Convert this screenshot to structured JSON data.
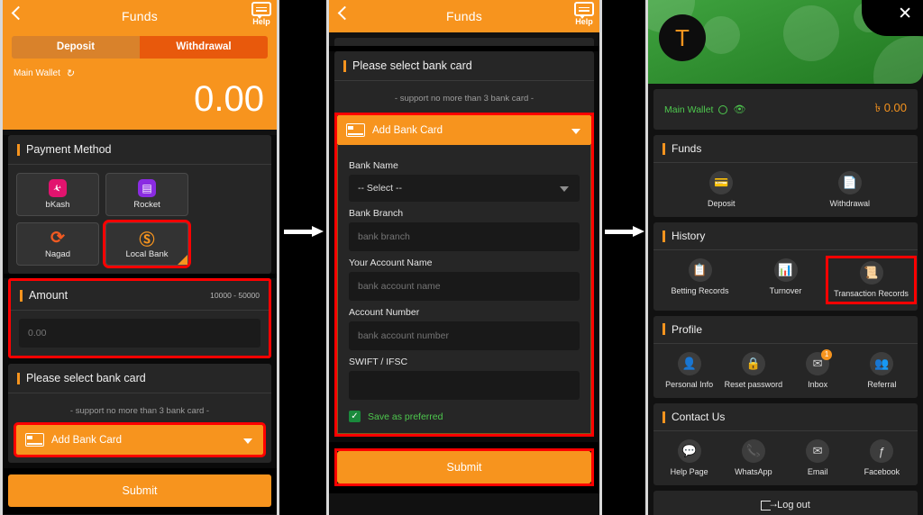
{
  "panels": {
    "left": {
      "header": {
        "title": "Funds",
        "help_label": "Help",
        "back_icon": "back-chevron-icon",
        "help_icon": "help-chat-icon"
      },
      "tabs": [
        {
          "label": "Deposit",
          "active": false
        },
        {
          "label": "Withdrawal",
          "active": true
        }
      ],
      "wallet": {
        "label": "Main Wallet",
        "refresh_icon": "refresh-icon",
        "balance": "0.00"
      },
      "payment_method": {
        "title": "Payment Method",
        "methods": [
          {
            "label": "bKash",
            "icon": "bkash-icon",
            "selected": false
          },
          {
            "label": "Rocket",
            "icon": "rocket-icon",
            "selected": false
          },
          {
            "label": "Nagad",
            "icon": "nagad-icon",
            "selected": false
          },
          {
            "label": "Local Bank",
            "icon": "local-bank-icon",
            "selected": true
          }
        ]
      },
      "amount": {
        "title": "Amount",
        "range": "10000 - 50000",
        "placeholder": "0.00",
        "value": ""
      },
      "bank_card": {
        "title": "Please select bank card",
        "note": "- support no more than 3 bank card -",
        "add_label": "Add Bank Card",
        "card_icon": "bank-card-icon",
        "caret_icon": "chevron-down-icon"
      },
      "submit_label": "Submit"
    },
    "mid": {
      "header": {
        "title": "Funds",
        "help_label": "Help",
        "back_icon": "back-chevron-icon",
        "help_icon": "help-chat-icon"
      },
      "bank_card": {
        "title": "Please select bank card",
        "note": "- support no more than 3 bank card -",
        "add_label": "Add Bank Card",
        "card_icon": "bank-card-icon",
        "caret_icon": "chevron-down-icon"
      },
      "form": {
        "fields": [
          {
            "label": "Bank Name",
            "type": "select",
            "value": "-- Select --",
            "placeholder": ""
          },
          {
            "label": "Bank Branch",
            "type": "text",
            "value": "",
            "placeholder": "bank branch"
          },
          {
            "label": "Your Account Name",
            "type": "text",
            "value": "",
            "placeholder": "bank account name"
          },
          {
            "label": "Account Number",
            "type": "text",
            "value": "",
            "placeholder": "bank account number"
          },
          {
            "label": "SWIFT / IFSC",
            "type": "text",
            "value": "",
            "placeholder": ""
          }
        ],
        "checkbox": {
          "label": "Save as preferred",
          "checked": true
        }
      },
      "submit_label": "Submit"
    },
    "right": {
      "avatar_initial": "T",
      "close_icon": "close-icon",
      "wallet": {
        "label": "Main Wallet",
        "refresh_icon": "refresh-icon",
        "eye_icon": "eye-icon",
        "balance": "৳ 0.00"
      },
      "sections": [
        {
          "title": "Funds",
          "items": [
            {
              "label": "Deposit",
              "icon": "deposit-card-icon",
              "highlighted": false,
              "badge": ""
            },
            {
              "label": "Withdrawal",
              "icon": "withdrawal-card-icon",
              "highlighted": false,
              "badge": ""
            }
          ]
        },
        {
          "title": "History",
          "items": [
            {
              "label": "Betting Records",
              "icon": "betting-records-icon",
              "highlighted": false,
              "badge": ""
            },
            {
              "label": "Turnover",
              "icon": "turnover-icon",
              "highlighted": false,
              "badge": ""
            },
            {
              "label": "Transaction Records",
              "icon": "transaction-records-icon",
              "highlighted": true,
              "badge": ""
            }
          ]
        },
        {
          "title": "Profile",
          "items": [
            {
              "label": "Personal Info",
              "icon": "person-icon",
              "highlighted": false,
              "badge": ""
            },
            {
              "label": "Reset password",
              "icon": "lock-icon",
              "highlighted": false,
              "badge": ""
            },
            {
              "label": "Inbox",
              "icon": "envelope-icon",
              "highlighted": false,
              "badge": "1"
            },
            {
              "label": "Referral",
              "icon": "referral-icon",
              "highlighted": false,
              "badge": ""
            }
          ]
        },
        {
          "title": "Contact Us",
          "items": [
            {
              "label": "Help Page",
              "icon": "help-page-icon",
              "highlighted": false,
              "badge": ""
            },
            {
              "label": "WhatsApp",
              "icon": "whatsapp-icon",
              "highlighted": false,
              "badge": ""
            },
            {
              "label": "Email",
              "icon": "email-icon",
              "highlighted": false,
              "badge": ""
            },
            {
              "label": "Facebook",
              "icon": "facebook-icon",
              "highlighted": false,
              "badge": ""
            }
          ]
        }
      ],
      "logout_label": "Log out",
      "logout_icon": "logout-icon"
    }
  },
  "flow": {
    "arrow_icon": "right-arrow-icon"
  },
  "colors": {
    "accent": "#F7941E",
    "active_tab": "#E8590C",
    "highlight": "#FF0000",
    "green": "#2E8B2E",
    "success": "#4EC94E"
  }
}
